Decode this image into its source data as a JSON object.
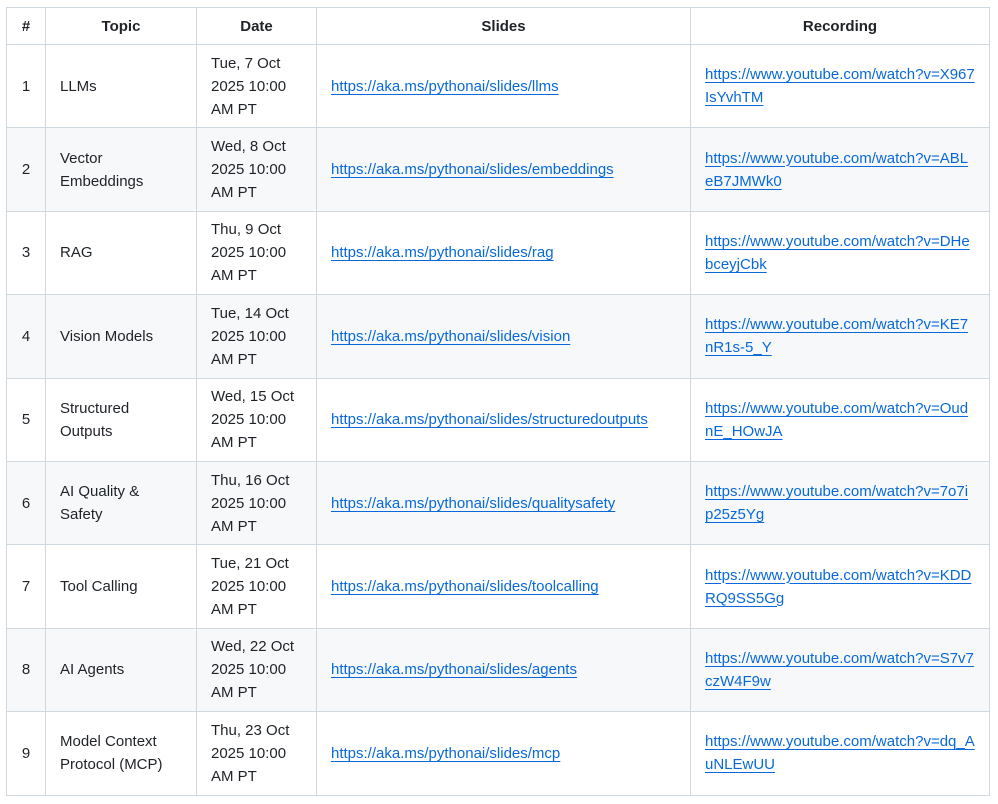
{
  "table": {
    "headers": [
      "#",
      "Topic",
      "Date",
      "Slides",
      "Recording"
    ],
    "rows": [
      {
        "num": "1",
        "topic": "LLMs",
        "date": "Tue, 7 Oct 2025 10:00 AM PT",
        "slides": "https://aka.ms/pythonai/slides/llms",
        "recording": "https://www.youtube.com/watch?v=X967IsYvhTM"
      },
      {
        "num": "2",
        "topic": "Vector Embeddings",
        "date": "Wed, 8 Oct 2025 10:00 AM PT",
        "slides": "https://aka.ms/pythonai/slides/embeddings",
        "recording": "https://www.youtube.com/watch?v=ABLeB7JMWk0"
      },
      {
        "num": "3",
        "topic": "RAG",
        "date": "Thu, 9 Oct 2025 10:00 AM PT",
        "slides": "https://aka.ms/pythonai/slides/rag",
        "recording": "https://www.youtube.com/watch?v=DHebceyjCbk"
      },
      {
        "num": "4",
        "topic": "Vision Models",
        "date": "Tue, 14 Oct 2025 10:00 AM PT",
        "slides": "https://aka.ms/pythonai/slides/vision",
        "recording": "https://www.youtube.com/watch?v=KE7nR1s-5_Y"
      },
      {
        "num": "5",
        "topic": "Structured Outputs",
        "date": "Wed, 15 Oct 2025 10:00 AM PT",
        "slides": "https://aka.ms/pythonai/slides/structuredoutputs",
        "recording": "https://www.youtube.com/watch?v=OudnE_HOwJA"
      },
      {
        "num": "6",
        "topic": "AI Quality & Safety",
        "date": "Thu, 16 Oct 2025 10:00 AM PT",
        "slides": "https://aka.ms/pythonai/slides/qualitysafety",
        "recording": "https://www.youtube.com/watch?v=7o7ip25z5Yg"
      },
      {
        "num": "7",
        "topic": "Tool Calling",
        "date": "Tue, 21 Oct 2025 10:00 AM PT",
        "slides": "https://aka.ms/pythonai/slides/toolcalling",
        "recording": "https://www.youtube.com/watch?v=KDDRQ9SS5Gg"
      },
      {
        "num": "8",
        "topic": "AI Agents",
        "date": "Wed, 22 Oct 2025 10:00 AM PT",
        "slides": "https://aka.ms/pythonai/slides/agents",
        "recording": "https://www.youtube.com/watch?v=S7v7czW4F9w"
      },
      {
        "num": "9",
        "topic": "Model Context Protocol (MCP)",
        "date": "Thu, 23 Oct 2025 10:00 AM PT",
        "slides": "https://aka.ms/pythonai/slides/mcp",
        "recording": "https://www.youtube.com/watch?v=dq_AuNLEwUU"
      }
    ]
  },
  "colors": {
    "link": "#0969da",
    "border": "#d1d9e0",
    "stripe": "#f6f8fa",
    "text": "#1f2328"
  }
}
